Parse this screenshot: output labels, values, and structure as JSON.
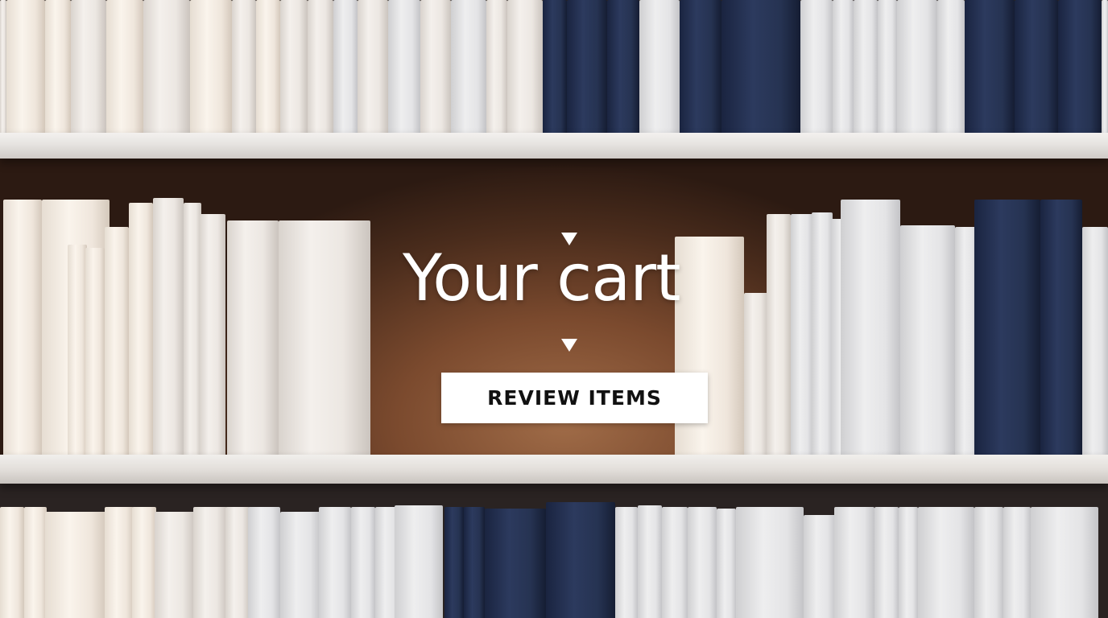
{
  "hero": {
    "title": "Your cart",
    "cta_label": "REVIEW ITEMS"
  },
  "theme": {
    "accent_text": "#ffffff",
    "button_bg": "#ffffff",
    "button_text": "#111111",
    "backdrop": "#7b4a2e",
    "navy_book": "#263352"
  },
  "icons": [
    "chevron-down-icon",
    "chevron-down-icon"
  ]
}
